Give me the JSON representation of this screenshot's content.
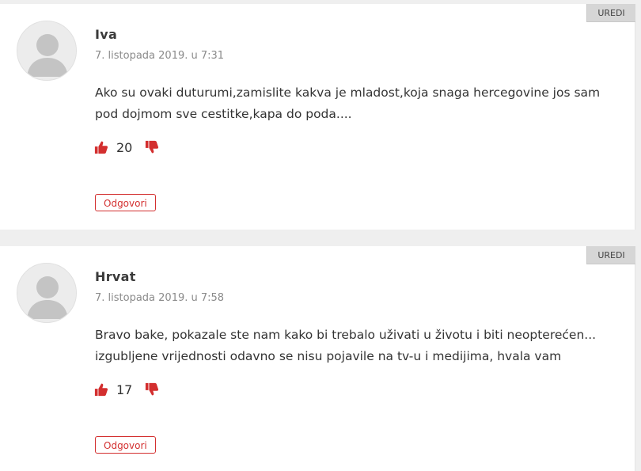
{
  "comments": [
    {
      "edit_label": "UREDI",
      "author": "Iva",
      "date": "7. listopada 2019. u 7:31",
      "text": "Ako su ovaki duturumi,zamislite kakva je mladost,koja snaga hercegovine jos sam pod dojmom sve cestitke,kapa do poda....",
      "likes": "20",
      "reply_label": "Odgovori"
    },
    {
      "edit_label": "UREDI",
      "author": "Hrvat",
      "date": "7. listopada 2019. u 7:58",
      "text": "Bravo bake, pokazale ste nam kako bi trebalo uživati u životu i biti neopterećen... izgubljene vrijednosti odavno se nisu pojavile na tv-u i medijima, hvala vam",
      "likes": "17",
      "reply_label": "Odgovori"
    }
  ],
  "icons": {
    "like": "thumbs-up-icon",
    "dislike": "thumbs-down-icon",
    "avatar": "default-avatar-icon"
  },
  "colors": {
    "accent": "#d32f2f",
    "edit_button_bg": "#d6d6d6",
    "background": "#efefef"
  }
}
